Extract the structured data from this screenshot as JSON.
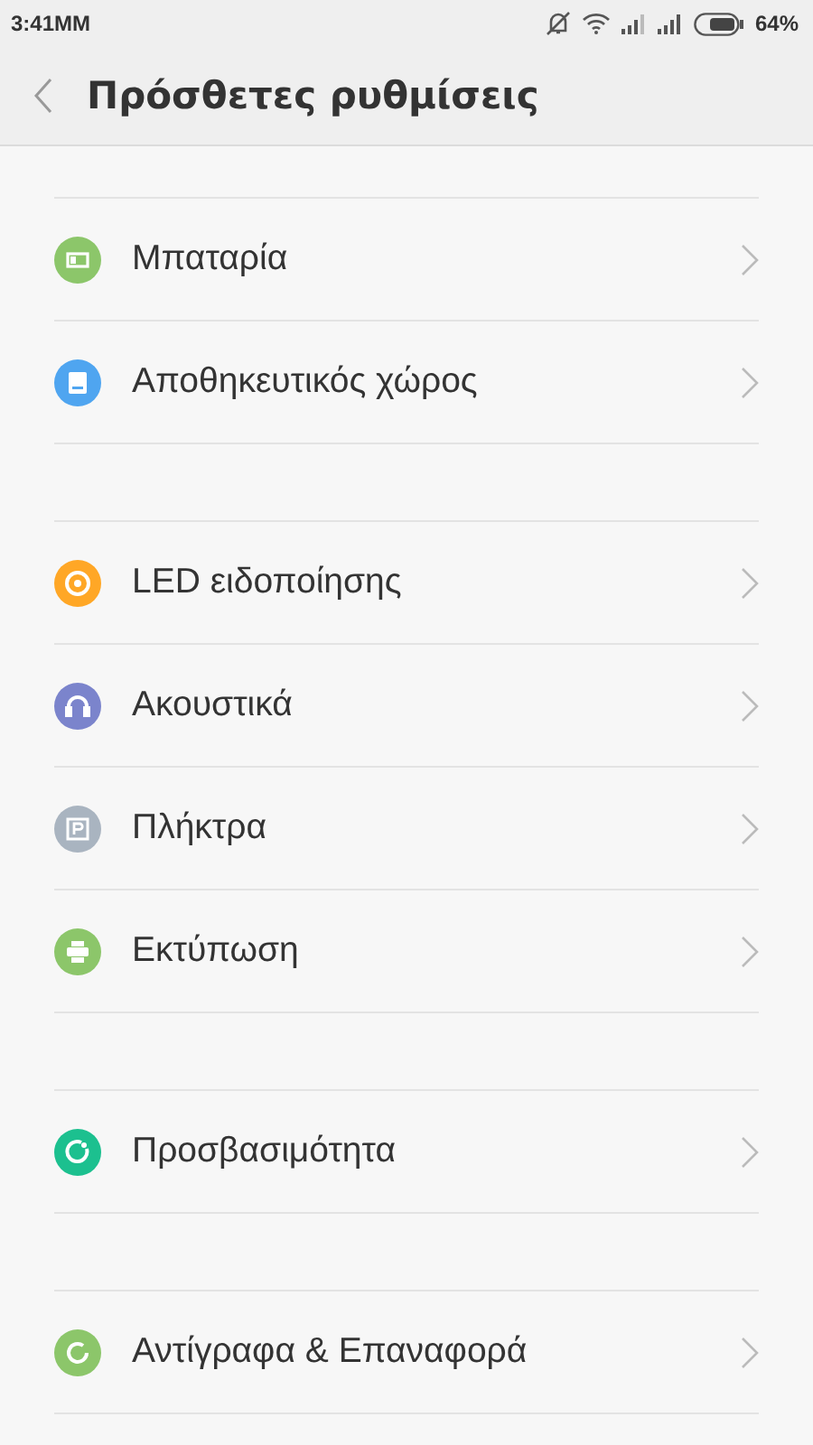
{
  "status_bar": {
    "time": "3:41MM",
    "battery": "64%"
  },
  "header": {
    "title": "Πρόσθετες ρυθμίσεις"
  },
  "groups": [
    {
      "items": [
        {
          "label": "Μπαταρία",
          "kind": "battery",
          "color": "#8cc66a"
        },
        {
          "label": "Αποθηκευτικός χώρος",
          "kind": "storage",
          "color": "#4fa5f0"
        }
      ]
    },
    {
      "items": [
        {
          "label": "LED ειδοποίησης",
          "kind": "led",
          "color": "#ffa726"
        },
        {
          "label": "Ακουστικά",
          "kind": "headphones",
          "color": "#7b84cc"
        },
        {
          "label": "Πλήκτρα",
          "kind": "keys",
          "color": "#a9b4c0"
        },
        {
          "label": "Εκτύπωση",
          "kind": "printer",
          "color": "#8cc66a"
        }
      ]
    },
    {
      "items": [
        {
          "label": "Προσβασιμότητα",
          "kind": "accessibility",
          "color": "#1cc08f"
        }
      ]
    },
    {
      "items": [
        {
          "label": "Αντίγραφα & Επαναφορά",
          "kind": "backup",
          "color": "#8cc66a"
        }
      ]
    }
  ]
}
